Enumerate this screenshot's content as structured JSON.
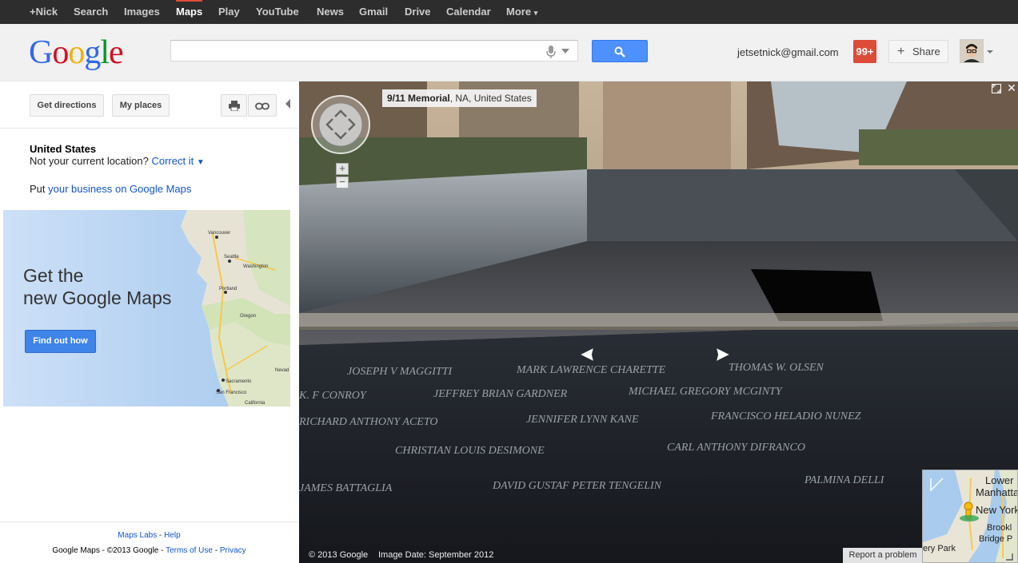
{
  "topbar": {
    "items": [
      "+Nick",
      "Search",
      "Images",
      "Maps",
      "Play",
      "YouTube",
      "News",
      "Gmail",
      "Drive",
      "Calendar",
      "More"
    ],
    "selected": "Maps",
    "more_caret": "▾"
  },
  "header": {
    "logo_letters": [
      "G",
      "o",
      "o",
      "g",
      "l",
      "e"
    ],
    "logo_colors": [
      "#3369e8",
      "#d50f25",
      "#eeb211",
      "#3369e8",
      "#009925",
      "#d50f25"
    ],
    "search_value": "",
    "account_email": "jetsetnick@gmail.com",
    "notifications": "99+",
    "share_label": "Share",
    "share_plus": "+"
  },
  "left": {
    "get_directions": "Get directions",
    "my_places": "My places",
    "country": "United States",
    "not_location": "Not your current location?",
    "correct_it": "Correct it",
    "correct_caret": "▼",
    "put_prefix": "Put",
    "business_link": "your business on Google Maps",
    "promo": {
      "line1": "Get the",
      "line2": "new Google Maps",
      "button": "Find out how",
      "map_labels": [
        "Vancouver",
        "Seattle",
        "Washington",
        "Portland",
        "Oregon",
        "Sacramento",
        "San Francisco",
        "California",
        "Nevad"
      ]
    },
    "footer": {
      "labs": "Maps Labs",
      "sep": " - ",
      "help": "Help",
      "copyright": "Google Maps - ©2013 Google - ",
      "terms": "Terms of Use",
      "privacy": "Privacy"
    }
  },
  "streetview": {
    "place_bold": "9/11 Memorial",
    "place_rest": ", NA, United States",
    "copyright": "© 2013 Google",
    "image_date": "Image Date: September 2012",
    "report": "Report a problem",
    "close": "✕",
    "zoom_in": "+",
    "zoom_out": "−",
    "nav_prev": "‹",
    "nav_next": "›",
    "engraved_names": [
      "JOSEPH V MAGGITTI",
      "MARK LAWRENCE CHARETTE",
      "THOMAS W. OLSEN",
      "K. F CONROY",
      "JEFFREY BRIAN GARDNER",
      "MICHAEL GREGORY MCGINTY",
      "RICHARD ANTHONY ACETO",
      "JENNIFER LYNN KANE",
      "FRANCISCO HELADIO NUNEZ",
      "CHRISTIAN LOUIS DESIMONE",
      "CARL ANTHONY DIFRANCO",
      "JAMES BATTAGLIA",
      "DAVID GUSTAF PETER TENGELIN",
      "PALMINA DELLI"
    ],
    "minimap": {
      "labels": [
        "Lower",
        "Manhattan",
        "New York",
        "Brookl",
        "Bridge P",
        "ery Park"
      ]
    }
  },
  "colors": {
    "topbar_bg": "#2d2d2d",
    "accent_blue": "#4d90fe",
    "notif_red": "#dd4b39",
    "link_blue": "#1155cc"
  }
}
